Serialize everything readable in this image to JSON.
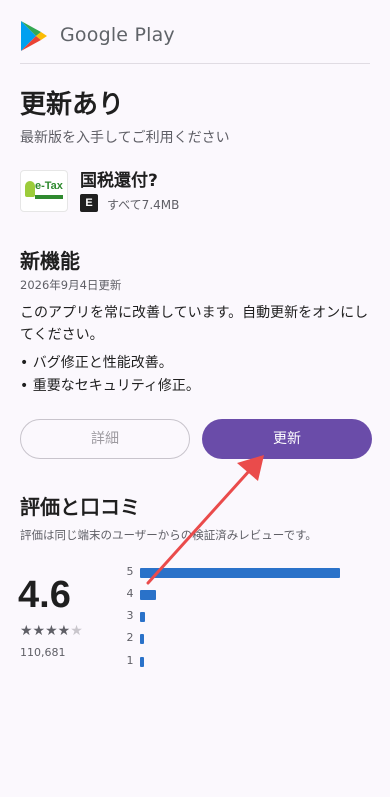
{
  "header": {
    "brand": "Google Play",
    "logo_icon": "google-play-logo"
  },
  "page": {
    "title": "更新あり",
    "subtitle": "最新版を入手してご利用ください"
  },
  "app": {
    "name": "国税還付?",
    "icon_text": "e-Tax",
    "content_rating": "E",
    "size": "すべて7.4MB"
  },
  "new_features": {
    "title": "新機能",
    "date": "2026年9月4日更新",
    "body": "このアプリを常に改善しています。自動更新をオンにしてください。",
    "bullets": [
      "• バグ修正と性能改善。",
      "• 重要なセキュリティ修正。"
    ]
  },
  "buttons": {
    "details": "詳細",
    "update": "更新"
  },
  "reviews": {
    "title": "評価と口コミ",
    "subtitle": "評価は同じ端末のユーザーからの検証済みレビューです。",
    "score": "4.6",
    "stars": "★★★★",
    "half_star": "★",
    "count": "110,681",
    "histogram": [
      {
        "label": "5",
        "fraction": 0.85
      },
      {
        "label": "4",
        "fraction": 0.07
      },
      {
        "label": "3",
        "fraction": 0.02
      },
      {
        "label": "2",
        "fraction": 0.015
      },
      {
        "label": "1",
        "fraction": 0.015
      }
    ]
  },
  "colors": {
    "accent": "#6a4ca9",
    "annotation_arrow": "#ea4b4b",
    "histogram_bar": "#2a72c9"
  }
}
